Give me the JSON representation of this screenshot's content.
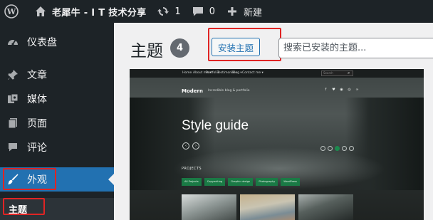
{
  "admin_bar": {
    "wp_logo_icon": "wordpress-icon",
    "site_name": "老犀牛 - I T 技术分享",
    "updates_count": "1",
    "comments_count": "0",
    "new_label": "新建"
  },
  "sidebar": {
    "items": [
      {
        "label": "仪表盘",
        "icon": "dashboard-icon"
      },
      {
        "label": "文章",
        "icon": "pin-icon"
      },
      {
        "label": "媒体",
        "icon": "media-icon"
      },
      {
        "label": "页面",
        "icon": "page-icon"
      },
      {
        "label": "评论",
        "icon": "comment-icon"
      },
      {
        "label": "外观",
        "icon": "paintbrush-icon",
        "active": true
      }
    ],
    "submenu": {
      "label": "主题"
    }
  },
  "main": {
    "title": "主题",
    "count": "4",
    "install_button": "安装主题",
    "search_placeholder": "搜索已安装的主题..."
  },
  "theme_preview": {
    "nav": [
      "Home",
      "About me ▾",
      "Portfolio",
      "Testimonials",
      "Blog ▾",
      "Contact me ▾"
    ],
    "search_placeholder": "Search",
    "logo": "Modern",
    "tagline": "Incredible blog & portfolio",
    "heading": "Style guide",
    "section_label": "PROJECTS",
    "tags": [
      "All Projects",
      "Copywriting",
      "Graphic design",
      "Photography",
      "WordPress"
    ]
  },
  "colors": {
    "admin_bg": "#1d2327",
    "accent": "#2271b1",
    "highlight_box": "#e02424",
    "tag_green": "#1a7a45"
  }
}
